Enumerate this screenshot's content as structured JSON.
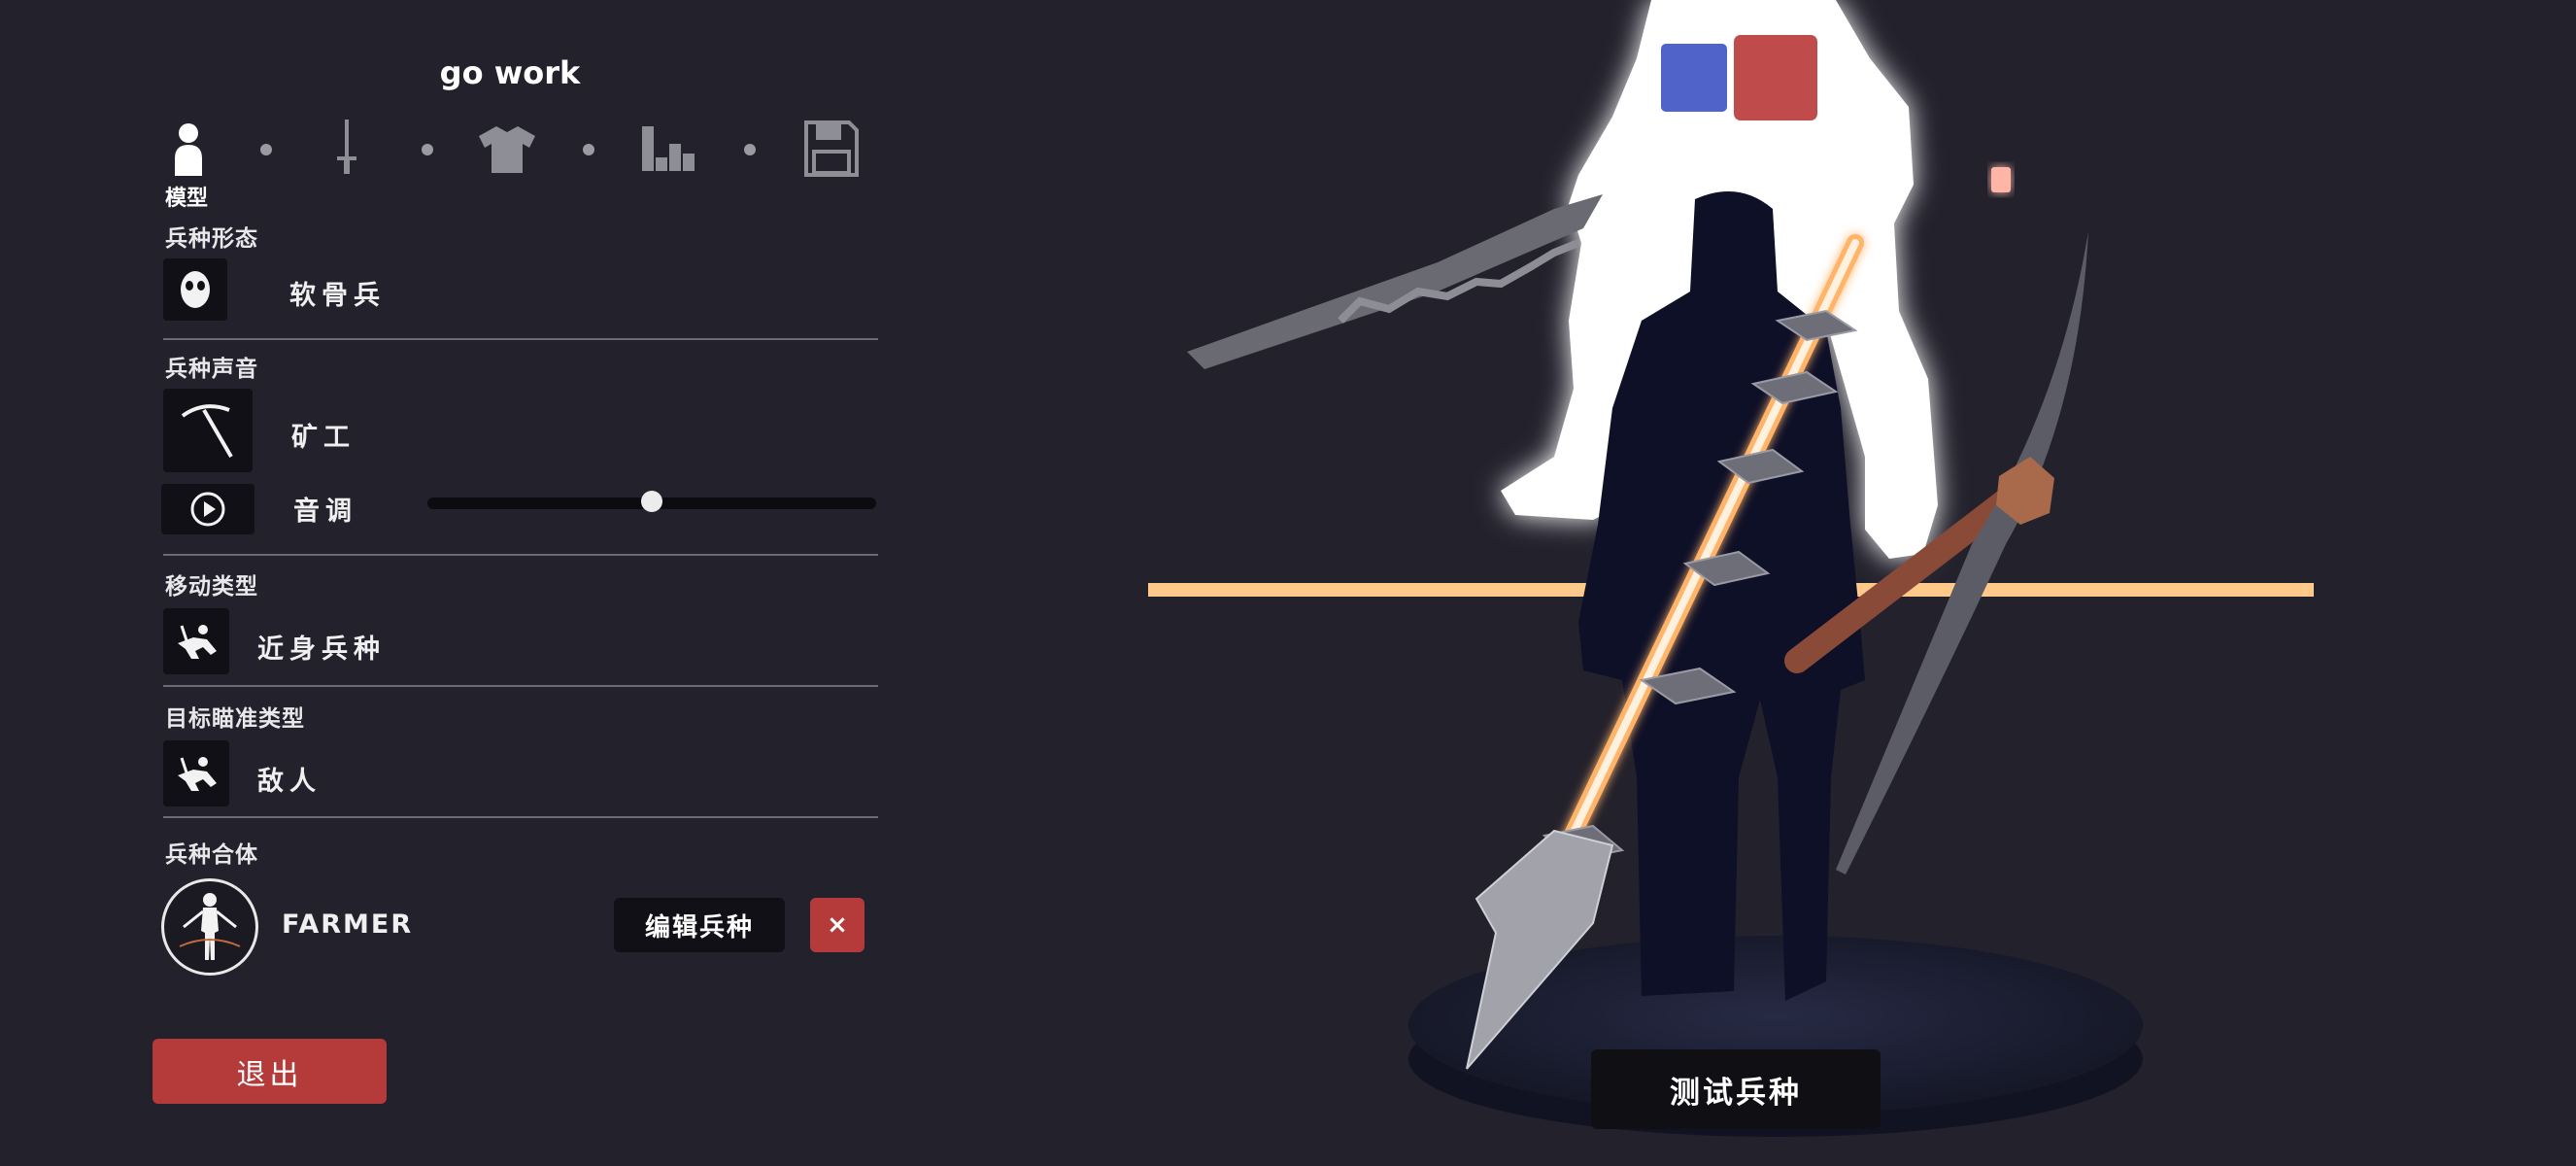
{
  "header": {
    "title": "go work"
  },
  "tabs": [
    {
      "name": "person-icon",
      "active": true
    },
    {
      "name": "sword-icon",
      "active": false
    },
    {
      "name": "shirt-icon",
      "active": false
    },
    {
      "name": "stats-icon",
      "active": false
    },
    {
      "name": "save-icon",
      "active": false
    }
  ],
  "section": {
    "subtitle": "模型"
  },
  "unit_form": {
    "label": "兵种形态",
    "value": "软骨兵",
    "icon": "mask-face-icon"
  },
  "unit_voice": {
    "label": "兵种声音",
    "value": "矿工",
    "icon": "pickaxe-icon",
    "pitch_label": "音调",
    "pitch_level": 0.5,
    "play_icon": "play-icon"
  },
  "movement": {
    "label": "移动类型",
    "value": "近身兵种",
    "icon": "melee-unit-icon"
  },
  "targeting": {
    "label": "目标瞄准类型",
    "value": "敌人",
    "icon": "melee-unit-icon"
  },
  "combine": {
    "label": "兵种合体",
    "unit_name": "FARMER",
    "edit_label": "编辑兵种",
    "remove_label": "×",
    "icon": "unit-figure-icon"
  },
  "footer": {
    "exit_label": "退出"
  },
  "scene": {
    "test_label": "测试兵种",
    "team_colors": [
      "#4f63c9",
      "#c04b4b"
    ]
  },
  "colors": {
    "background": "#23212c",
    "accent_red": "#b53b3b",
    "glow": "#ffffff",
    "spear_glow": "#ffb46a"
  }
}
